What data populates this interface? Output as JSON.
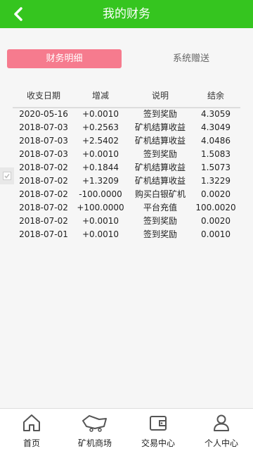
{
  "header": {
    "title": "我的财务"
  },
  "tabs": [
    {
      "label": "财务明细",
      "active": true
    },
    {
      "label": "系统赠送",
      "active": false
    }
  ],
  "table": {
    "headers": [
      "收支日期",
      "增减",
      "说明",
      "结余"
    ],
    "rows": [
      [
        "2020-05-16",
        "+0.0010",
        "签到奖励",
        "4.3059"
      ],
      [
        "2018-07-03",
        "+0.2563",
        "矿机结算收益",
        "4.3049"
      ],
      [
        "2018-07-03",
        "+2.5402",
        "矿机结算收益",
        "4.0486"
      ],
      [
        "2018-07-03",
        "+0.0010",
        "签到奖励",
        "1.5083"
      ],
      [
        "2018-07-02",
        "+0.1844",
        "矿机结算收益",
        "1.5073"
      ],
      [
        "2018-07-02",
        "+1.3209",
        "矿机结算收益",
        "1.3229"
      ],
      [
        "2018-07-02",
        "-100.0000",
        "购买白银矿机",
        "0.0020"
      ],
      [
        "2018-07-02",
        "+100.0000",
        "平台充值",
        "100.0020"
      ],
      [
        "2018-07-02",
        "+0.0010",
        "签到奖励",
        "0.0020"
      ],
      [
        "2018-07-01",
        "+0.0010",
        "签到奖励",
        "0.0010"
      ]
    ]
  },
  "bottom_nav": [
    {
      "label": "首页",
      "icon": "home-icon"
    },
    {
      "label": "矿机商场",
      "icon": "mining-machine-icon"
    },
    {
      "label": "交易中心",
      "icon": "wallet-icon"
    },
    {
      "label": "个人中心",
      "icon": "user-icon"
    }
  ],
  "colors": {
    "header": "#35c51f",
    "active_tab": "#f67b8e"
  }
}
